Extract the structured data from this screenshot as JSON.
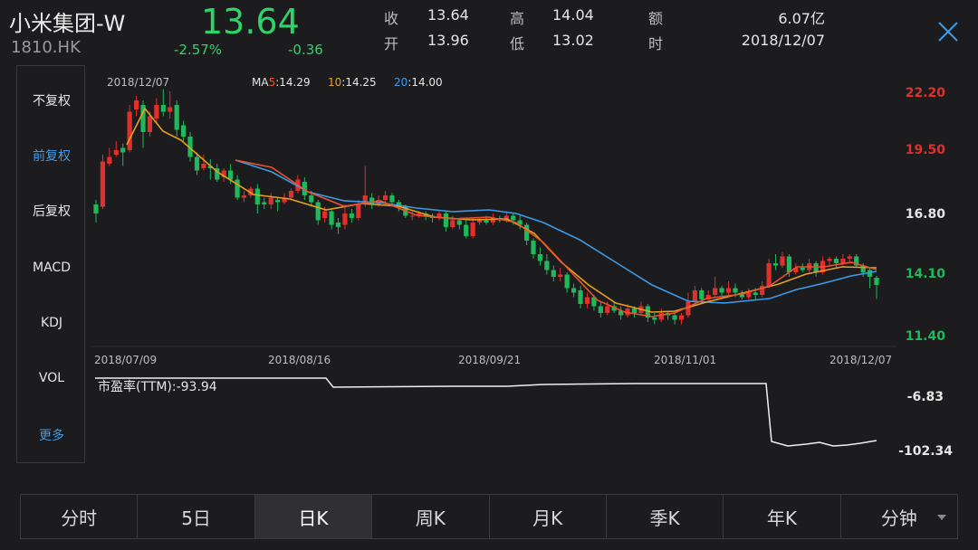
{
  "header": {
    "name": "小米集团-W",
    "code": "1810.HK",
    "price": "13.64",
    "change_pct": "-2.57%",
    "change_abs": "-0.36"
  },
  "quote": {
    "close_label": "收",
    "close_value": "13.64",
    "high_label": "高",
    "high_value": "14.04",
    "amount_label": "额",
    "amount_value": "6.07亿",
    "open_label": "开",
    "open_value": "13.96",
    "low_label": "低",
    "low_value": "13.02",
    "time_label": "时",
    "time_value": "2018/12/07"
  },
  "left_menu": {
    "items": [
      "不复权",
      "前复权",
      "后复权",
      "MACD",
      "KDJ",
      "VOL",
      "更多"
    ],
    "active": "前复权"
  },
  "chart_data": {
    "type": "candlestick",
    "hover_date": "2018/12/07",
    "ma": [
      {
        "prefix": "MA",
        "period": "5",
        "value": ":14.29",
        "color": "#e8532f"
      },
      {
        "period": "10",
        "value": ":14.25",
        "color": "#e6a020"
      },
      {
        "period": "20",
        "value": ":14.00",
        "color": "#3b9bea"
      }
    ],
    "price_axis": [
      "22.20",
      "19.50",
      "16.80",
      "14.10",
      "11.40"
    ],
    "ylim": [
      11.4,
      22.2
    ],
    "date_ticks": [
      "2018/07/09",
      "2018/08/16",
      "2018/09/21",
      "2018/11/01",
      "2018/12/07"
    ],
    "candles": [
      [
        17.2,
        16.8,
        17.4,
        16.4
      ],
      [
        17.1,
        19.1,
        19.4,
        17.0
      ],
      [
        19.0,
        19.3,
        19.7,
        18.9
      ],
      [
        19.4,
        19.6,
        20.0,
        19.3
      ],
      [
        19.7,
        19.5,
        19.9,
        18.9
      ],
      [
        19.6,
        21.3,
        21.6,
        19.5
      ],
      [
        21.4,
        21.8,
        22.0,
        21.1
      ],
      [
        21.6,
        20.4,
        21.8,
        19.7
      ],
      [
        20.4,
        21.1,
        21.3,
        20.2
      ],
      [
        21.0,
        21.6,
        21.9,
        20.8
      ],
      [
        21.6,
        21.3,
        22.3,
        21.1
      ],
      [
        21.3,
        21.5,
        22.2,
        21.0
      ],
      [
        21.6,
        20.5,
        21.8,
        20.2
      ],
      [
        20.7,
        20.2,
        20.9,
        20.0
      ],
      [
        20.2,
        19.3,
        20.4,
        19.1
      ],
      [
        19.3,
        18.7,
        19.5,
        18.5
      ],
      [
        18.8,
        19.0,
        19.4,
        18.7
      ],
      [
        18.9,
        18.8,
        19.2,
        18.3
      ],
      [
        18.8,
        18.3,
        19.0,
        18.2
      ],
      [
        18.4,
        18.7,
        18.8,
        18.2
      ],
      [
        18.7,
        18.3,
        19.0,
        18.1
      ],
      [
        18.3,
        17.5,
        18.5,
        17.4
      ],
      [
        17.5,
        17.6,
        17.8,
        17.3
      ],
      [
        17.6,
        17.9,
        18.0,
        17.5
      ],
      [
        17.9,
        17.2,
        18.1,
        16.8
      ],
      [
        17.3,
        17.2,
        17.5,
        17.0
      ],
      [
        17.2,
        17.5,
        17.7,
        17.0
      ],
      [
        17.4,
        17.3,
        17.5,
        16.9
      ],
      [
        17.3,
        17.5,
        17.7,
        17.2
      ],
      [
        17.5,
        17.8,
        17.9,
        17.4
      ],
      [
        17.8,
        18.3,
        18.5,
        17.7
      ],
      [
        18.2,
        17.6,
        18.4,
        17.4
      ],
      [
        17.6,
        17.3,
        17.8,
        17.1
      ],
      [
        17.3,
        16.5,
        17.4,
        16.3
      ],
      [
        16.6,
        16.9,
        17.1,
        16.4
      ],
      [
        16.9,
        16.3,
        17.0,
        16.1
      ],
      [
        16.4,
        16.2,
        16.6,
        15.9
      ],
      [
        16.3,
        16.8,
        17.2,
        16.1
      ],
      [
        16.8,
        16.6,
        17.0,
        16.4
      ],
      [
        16.6,
        17.2,
        17.4,
        16.5
      ],
      [
        17.2,
        17.6,
        18.9,
        17.1
      ],
      [
        17.5,
        17.2,
        17.7,
        17.0
      ],
      [
        17.2,
        17.4,
        17.6,
        17.1
      ],
      [
        17.4,
        17.6,
        17.8,
        17.2
      ],
      [
        17.6,
        17.3,
        17.7,
        17.1
      ],
      [
        17.3,
        17.1,
        17.4,
        16.9
      ],
      [
        17.1,
        16.7,
        17.2,
        16.6
      ],
      [
        16.7,
        16.7,
        16.9,
        16.5
      ],
      [
        16.7,
        16.8,
        16.9,
        16.6
      ],
      [
        16.8,
        16.7,
        16.9,
        16.5
      ],
      [
        16.7,
        16.6,
        16.8,
        16.4
      ],
      [
        16.6,
        16.8,
        16.9,
        16.5
      ],
      [
        16.8,
        16.2,
        16.9,
        16.0
      ],
      [
        16.2,
        16.5,
        16.7,
        16.1
      ],
      [
        16.5,
        16.3,
        16.6,
        16.1
      ],
      [
        16.3,
        15.8,
        16.5,
        15.7
      ],
      [
        15.8,
        16.4,
        16.6,
        15.7
      ],
      [
        16.4,
        16.5,
        16.6,
        16.3
      ],
      [
        16.5,
        16.4,
        16.7,
        16.3
      ],
      [
        16.4,
        16.6,
        16.8,
        16.3
      ],
      [
        16.6,
        16.5,
        16.7,
        16.4
      ],
      [
        16.5,
        16.7,
        16.9,
        16.4
      ],
      [
        16.7,
        16.5,
        16.8,
        16.3
      ],
      [
        16.5,
        16.3,
        16.7,
        16.1
      ],
      [
        16.3,
        15.6,
        16.4,
        15.4
      ],
      [
        15.6,
        15.0,
        15.7,
        14.8
      ],
      [
        15.0,
        14.7,
        15.3,
        14.5
      ],
      [
        14.7,
        14.3,
        15.0,
        14.1
      ],
      [
        14.3,
        14.0,
        14.5,
        13.8
      ],
      [
        14.0,
        14.1,
        14.4,
        13.8
      ],
      [
        14.1,
        13.5,
        14.2,
        13.3
      ],
      [
        13.5,
        13.3,
        13.7,
        13.1
      ],
      [
        13.4,
        12.8,
        13.6,
        12.6
      ],
      [
        12.8,
        13.1,
        13.3,
        12.6
      ],
      [
        13.1,
        12.7,
        13.2,
        12.5
      ],
      [
        12.7,
        12.4,
        12.9,
        12.2
      ],
      [
        12.4,
        12.7,
        12.9,
        12.3
      ],
      [
        12.7,
        12.5,
        12.9,
        12.4
      ],
      [
        12.5,
        12.3,
        12.7,
        12.1
      ],
      [
        12.3,
        12.6,
        12.8,
        12.2
      ],
      [
        12.6,
        12.4,
        12.7,
        12.2
      ],
      [
        12.4,
        12.7,
        12.9,
        12.3
      ],
      [
        12.7,
        12.2,
        12.8,
        12.0
      ],
      [
        12.2,
        12.1,
        12.4,
        11.9
      ],
      [
        12.1,
        12.4,
        12.6,
        12.0
      ],
      [
        12.4,
        12.3,
        12.5,
        12.1
      ],
      [
        12.3,
        12.1,
        12.4,
        11.9
      ],
      [
        12.1,
        12.3,
        12.4,
        11.9
      ],
      [
        12.3,
        12.9,
        13.3,
        12.2
      ],
      [
        12.9,
        13.4,
        13.6,
        12.8
      ],
      [
        13.4,
        13.0,
        13.5,
        12.8
      ],
      [
        13.0,
        13.2,
        13.4,
        12.9
      ],
      [
        13.2,
        13.5,
        14.0,
        13.1
      ],
      [
        13.5,
        13.3,
        13.6,
        13.1
      ],
      [
        13.3,
        13.5,
        13.8,
        13.2
      ],
      [
        13.5,
        13.3,
        13.7,
        13.1
      ],
      [
        13.3,
        13.1,
        13.4,
        13.0
      ],
      [
        13.1,
        13.3,
        13.5,
        13.0
      ],
      [
        13.3,
        13.2,
        13.5,
        13.0
      ],
      [
        13.2,
        13.6,
        13.8,
        13.1
      ],
      [
        13.6,
        14.6,
        14.8,
        13.5
      ],
      [
        14.6,
        14.5,
        15.0,
        14.3
      ],
      [
        14.5,
        14.9,
        15.1,
        14.4
      ],
      [
        14.9,
        14.2,
        15.0,
        14.0
      ],
      [
        14.2,
        14.4,
        14.6,
        14.1
      ],
      [
        14.4,
        14.3,
        14.6,
        14.2
      ],
      [
        14.3,
        14.6,
        14.8,
        14.2
      ],
      [
        14.6,
        14.2,
        14.7,
        14.0
      ],
      [
        14.2,
        14.7,
        14.9,
        14.1
      ],
      [
        14.7,
        14.8,
        14.9,
        14.5
      ],
      [
        14.8,
        14.6,
        14.9,
        14.4
      ],
      [
        14.6,
        14.8,
        15.0,
        14.5
      ],
      [
        14.8,
        14.9,
        15.0,
        14.6
      ],
      [
        14.9,
        14.5,
        15.0,
        14.4
      ],
      [
        14.5,
        14.2,
        14.6,
        14.0
      ],
      [
        14.3,
        14.0,
        14.4,
        13.5
      ],
      [
        13.96,
        13.64,
        14.04,
        13.02
      ]
    ],
    "ma5": [
      [
        260,
        177
      ],
      [
        300,
        185
      ],
      [
        340,
        212
      ],
      [
        380,
        228
      ],
      [
        420,
        222
      ],
      [
        460,
        238
      ],
      [
        500,
        242
      ],
      [
        540,
        240
      ],
      [
        570,
        246
      ],
      [
        600,
        268
      ],
      [
        630,
        300
      ],
      [
        660,
        332
      ],
      [
        690,
        345
      ],
      [
        720,
        350
      ],
      [
        745,
        346
      ],
      [
        780,
        330
      ],
      [
        820,
        325
      ],
      [
        850,
        316
      ],
      [
        880,
        295
      ],
      [
        910,
        295
      ],
      [
        940,
        290
      ],
      [
        968,
        298
      ]
    ],
    "ma10": [
      [
        140,
        160
      ],
      [
        160,
        120
      ],
      [
        180,
        145
      ],
      [
        200,
        155
      ],
      [
        240,
        190
      ],
      [
        280,
        215
      ],
      [
        320,
        220
      ],
      [
        360,
        232
      ],
      [
        400,
        225
      ],
      [
        440,
        228
      ],
      [
        480,
        240
      ],
      [
        520,
        243
      ],
      [
        560,
        242
      ],
      [
        590,
        258
      ],
      [
        620,
        290
      ],
      [
        650,
        315
      ],
      [
        680,
        335
      ],
      [
        720,
        345
      ],
      [
        745,
        344
      ],
      [
        780,
        334
      ],
      [
        820,
        324
      ],
      [
        860,
        314
      ],
      [
        890,
        303
      ],
      [
        930,
        295
      ],
      [
        968,
        296
      ]
    ],
    "ma20": [
      [
        260,
        177
      ],
      [
        300,
        190
      ],
      [
        340,
        212
      ],
      [
        380,
        222
      ],
      [
        420,
        224
      ],
      [
        460,
        230
      ],
      [
        500,
        234
      ],
      [
        540,
        232
      ],
      [
        570,
        236
      ],
      [
        600,
        246
      ],
      [
        640,
        265
      ],
      [
        680,
        290
      ],
      [
        720,
        315
      ],
      [
        760,
        333
      ],
      [
        800,
        335
      ],
      [
        850,
        330
      ],
      [
        880,
        320
      ],
      [
        910,
        313
      ],
      [
        940,
        305
      ],
      [
        968,
        300
      ]
    ],
    "pe_label": "市盈率(TTM):-93.94",
    "pe_axis": [
      "-6.83",
      "-102.34"
    ],
    "pe_line": [
      [
        105,
        418
      ],
      [
        360,
        418
      ],
      [
        368,
        428
      ],
      [
        500,
        427
      ],
      [
        560,
        427
      ],
      [
        600,
        425
      ],
      [
        700,
        424
      ],
      [
        760,
        424
      ],
      [
        846,
        424
      ],
      [
        852,
        488
      ],
      [
        870,
        493
      ],
      [
        890,
        491
      ],
      [
        905,
        489
      ],
      [
        920,
        493
      ],
      [
        935,
        492
      ],
      [
        950,
        490
      ],
      [
        968,
        487
      ]
    ]
  },
  "bottom_tabs": {
    "items": [
      "分时",
      "5日",
      "日K",
      "周K",
      "月K",
      "季K",
      "年K",
      "分钟"
    ],
    "active": "日K"
  },
  "colors": {
    "up": "#e0302c",
    "down": "#1fb85b",
    "accent": "#3b9bea",
    "price_green": "#2fd36a"
  }
}
